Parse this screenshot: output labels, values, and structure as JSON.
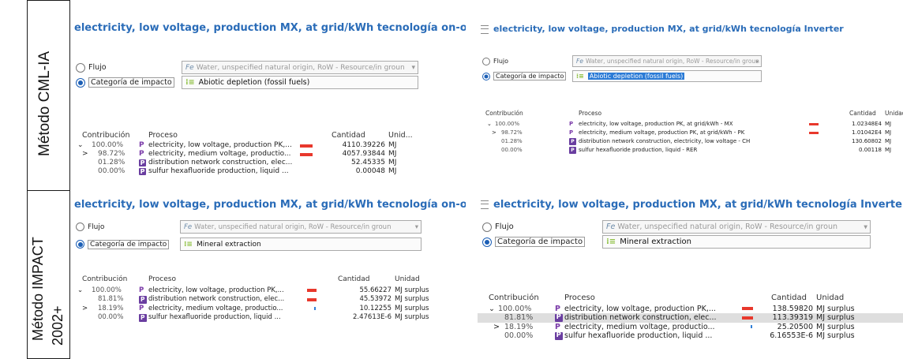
{
  "row_labels": {
    "cml": "Método CML-IA",
    "impact_a": "Método   IMPACT",
    "impact_b": "2002+"
  },
  "panels": [
    {
      "title": "electricity, low voltage, production MX, at grid/kWh tecnología on-off",
      "flujo_label": "Flujo",
      "flujo_value": "Water, unspecified natural origin, RoW - Resource/in groun",
      "flujo_icon": "Fe",
      "cat_label": "Categoría de impacto",
      "cat_value": "Abiotic depletion (fossil fuels)",
      "headers": {
        "contribution": "Contribución",
        "process": "Proceso",
        "amount": "Cantidad",
        "unit": "Unid..."
      },
      "rows": [
        {
          "expander": "⌄",
          "contribution": "100.00%",
          "badge": "P",
          "process": "electricity, low voltage, production PK,...",
          "amount": "4110.39226",
          "unit": "MJ",
          "bar": "red"
        },
        {
          "expander": ">",
          "contribution": "98.72%",
          "badge": "P",
          "process": "electricity, medium voltage, productio...",
          "amount": "4057.93844",
          "unit": "MJ",
          "bar": "red"
        },
        {
          "expander": "",
          "contribution": "01.28%",
          "badge": "P",
          "process": "distribution network construction, elec...",
          "amount": "52.45335",
          "unit": "MJ",
          "bar": ""
        },
        {
          "expander": "",
          "contribution": "00.00%",
          "badge": "P",
          "process": "sulfur hexafluoride production, liquid ...",
          "amount": "0.00048",
          "unit": "MJ",
          "bar": ""
        }
      ]
    },
    {
      "title": "electricity, low voltage, production MX, at grid/kWh tecnología Inverter",
      "flujo_label": "Flujo",
      "flujo_value": "Water, unspecified natural origin, RoW - Resource/in groun",
      "flujo_icon": "Fe",
      "cat_label": "Categoría de impacto",
      "cat_value": "Abiotic depletion (fossil fuels)",
      "headers": {
        "contribution": "Contribución",
        "process": "Proceso",
        "amount": "Cantidad",
        "unit": "Unidad"
      },
      "rows": [
        {
          "expander": "⌄",
          "contribution": "100.00%",
          "badge": "P",
          "process": "electricity, low voltage, production PK, at grid/kWh - MX",
          "amount": "1.02348E4",
          "unit": "MJ",
          "bar": "red"
        },
        {
          "expander": ">",
          "contribution": "98.72%",
          "badge": "P",
          "process": "electricity, medium voltage, production PK, at grid/kWh - PK",
          "amount": "1.01042E4",
          "unit": "MJ",
          "bar": "red"
        },
        {
          "expander": "",
          "contribution": "01.28%",
          "badge": "P",
          "process": "distribution network construction, electricity, low voltage - CH",
          "amount": "130.60802",
          "unit": "MJ",
          "bar": ""
        },
        {
          "expander": "",
          "contribution": "00.00%",
          "badge": "P",
          "process": "sulfur hexafluoride production, liquid - RER",
          "amount": "0.00118",
          "unit": "MJ",
          "bar": ""
        }
      ]
    },
    {
      "title": "electricity, low voltage, production MX, at grid/kWh tecnología on-off",
      "flujo_label": "Flujo",
      "flujo_value": "Water, unspecified natural origin, RoW - Resource/in groun",
      "flujo_icon": "Fe",
      "cat_label": "Categoría de impacto",
      "cat_value": "Mineral extraction",
      "headers": {
        "contribution": "Contribución",
        "process": "Proceso",
        "amount": "Cantidad",
        "unit": "Unidad"
      },
      "rows": [
        {
          "expander": "⌄",
          "contribution": "100.00%",
          "badge": "P",
          "process": "electricity, low voltage, production PK,...",
          "amount": "55.66227",
          "unit": "MJ surplus",
          "bar": "red"
        },
        {
          "expander": "",
          "contribution": "81.81%",
          "badge": "P",
          "process": "distribution network construction, elec...",
          "amount": "45.53972",
          "unit": "MJ surplus",
          "bar": "red"
        },
        {
          "expander": ">",
          "contribution": "18.19%",
          "badge": "P",
          "process": "electricity, medium voltage, productio...",
          "amount": "10.12255",
          "unit": "MJ surplus",
          "bar": "blue"
        },
        {
          "expander": "",
          "contribution": "00.00%",
          "badge": "P",
          "process": "sulfur hexafluoride production, liquid ...",
          "amount": "2.47613E-6",
          "unit": "MJ surplus",
          "bar": ""
        }
      ]
    },
    {
      "title": "electricity, low voltage, production MX, at grid/kWh tecnología Inverter",
      "flujo_label": "Flujo",
      "flujo_value": "Water, unspecified natural origin, RoW - Resource/in groun",
      "flujo_icon": "Fe",
      "cat_label": "Categoría de impacto",
      "cat_value": "Mineral extraction",
      "headers": {
        "contribution": "Contribución",
        "process": "Proceso",
        "amount": "Cantidad",
        "unit": "Unidad"
      },
      "rows": [
        {
          "expander": "⌄",
          "contribution": "100.00%",
          "badge": "P",
          "process": "electricity, low voltage, production PK,...",
          "amount": "138.59820",
          "unit": "MJ surplus",
          "bar": "red"
        },
        {
          "expander": "",
          "contribution": "81.81%",
          "badge": "P",
          "process": "distribution network construction, elec...",
          "amount": "113.39319",
          "unit": "MJ surplus",
          "bar": "red"
        },
        {
          "expander": ">",
          "contribution": "18.19%",
          "badge": "P",
          "process": "electricity, medium voltage, productio...",
          "amount": "25.20500",
          "unit": "MJ surplus",
          "bar": "blue"
        },
        {
          "expander": "",
          "contribution": "00.00%",
          "badge": "P",
          "process": "sulfur hexafluoride production, liquid ...",
          "amount": "6.16553E-6",
          "unit": "MJ surplus",
          "bar": ""
        }
      ]
    }
  ],
  "colors": {
    "title": "#2a6cb8",
    "badge": "#6a3ea0",
    "bar_red": "#e8382c",
    "bar_blue": "#2f7fd8",
    "selected_radio": "#1c5fb6"
  }
}
